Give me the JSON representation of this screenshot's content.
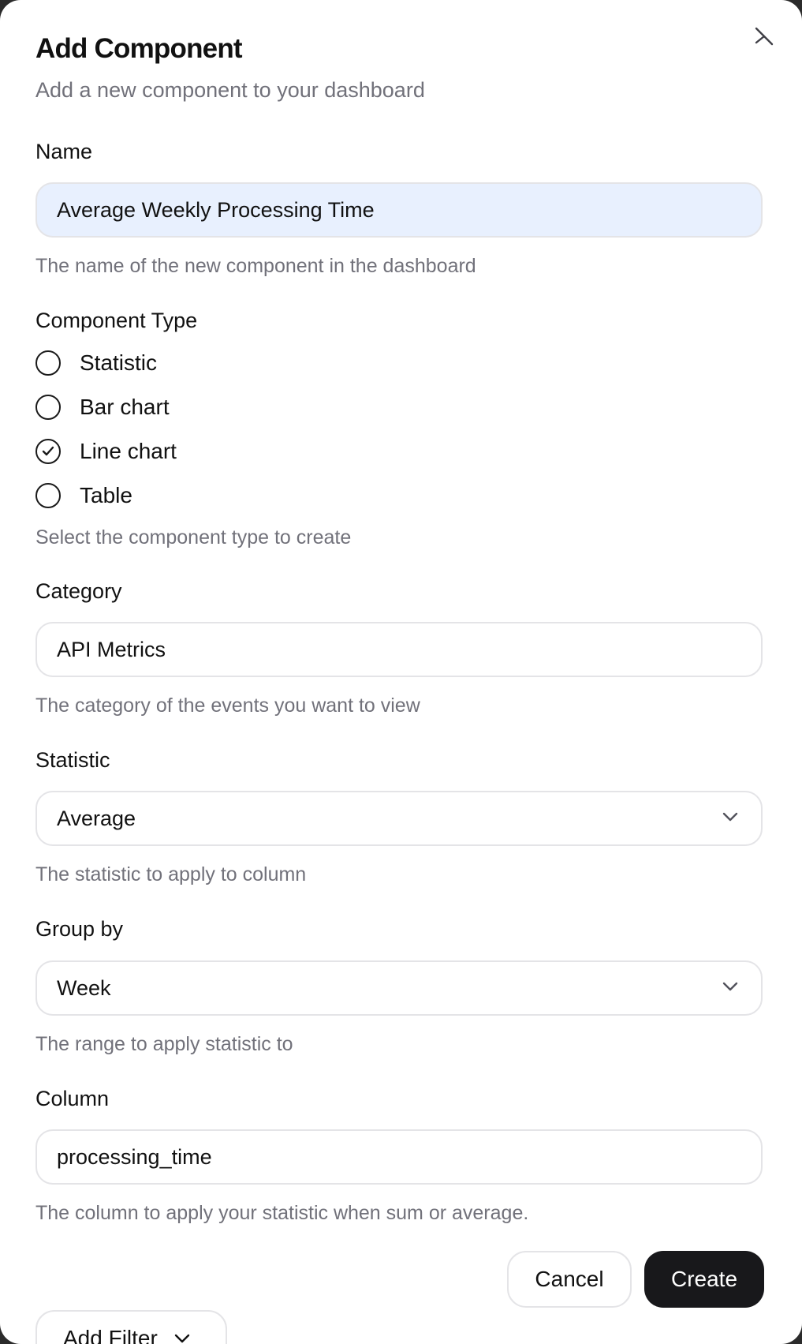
{
  "dialog": {
    "title": "Add Component",
    "subtitle": "Add a new component to your dashboard",
    "close_icon": "close-icon"
  },
  "name_field": {
    "label": "Name",
    "value": "Average Weekly Processing Time",
    "hint": "The name of the new component in the dashboard"
  },
  "component_type": {
    "label": "Component Type",
    "options": [
      {
        "label": "Statistic",
        "selected": false
      },
      {
        "label": "Bar chart",
        "selected": false
      },
      {
        "label": "Line chart",
        "selected": true
      },
      {
        "label": "Table",
        "selected": false
      }
    ],
    "hint": "Select the component type to create"
  },
  "category_field": {
    "label": "Category",
    "value": "API Metrics",
    "hint": "The category of the events you want to view"
  },
  "statistic_field": {
    "label": "Statistic",
    "value": "Average",
    "hint": "The statistic to apply to column",
    "icon": "chevron-down-icon"
  },
  "group_by_field": {
    "label": "Group by",
    "value": "Week",
    "hint": "The range to apply statistic to",
    "icon": "chevron-down-icon"
  },
  "column_field": {
    "label": "Column",
    "value": "processing_time",
    "hint": "The column to apply your statistic when sum or average."
  },
  "actions": {
    "cancel_label": "Cancel",
    "create_label": "Create",
    "add_filter_label": "Add Filter"
  }
}
